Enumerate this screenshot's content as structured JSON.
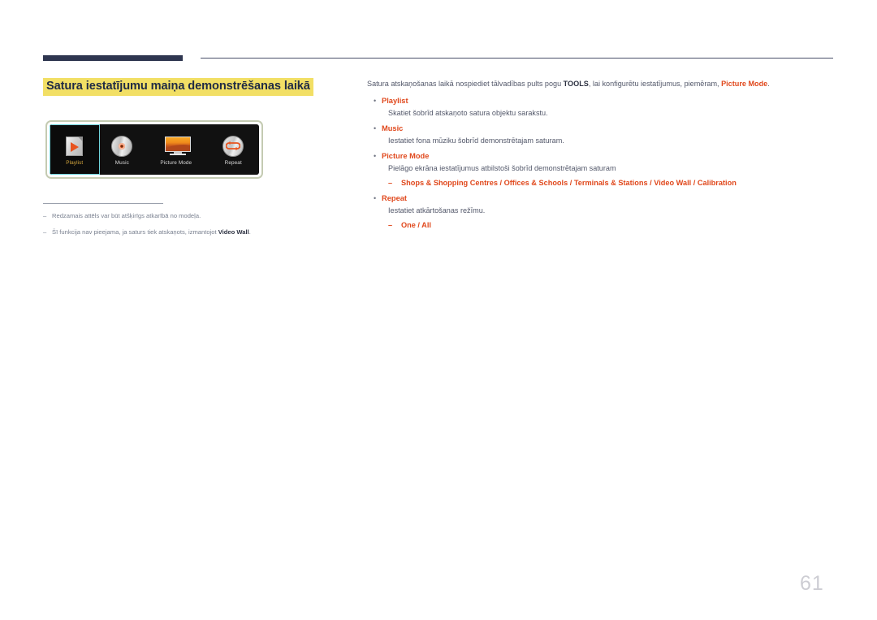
{
  "header": {
    "rule_color": "#2e3650",
    "thin_rule_color": "#4a4f68"
  },
  "left": {
    "title": "Satura iestatījumu maiņa demonstrēšanas laikā",
    "title_highlight_color": "#f2df65",
    "title_text_color": "#1f2a44",
    "device_panel": {
      "frame_color": "#c4cbb2",
      "background_color": "#111111",
      "selected_border_color": "#6fd3db",
      "selected_label_color": "#d8a93f",
      "accent_color": "#e8541f",
      "tiles": [
        {
          "icon": "playlist-document-play-icon",
          "label": "Playlist",
          "selected": true
        },
        {
          "icon": "music-disc-icon",
          "label": "Music",
          "selected": false
        },
        {
          "icon": "picture-mode-monitor-icon",
          "label": "Picture Mode",
          "selected": false
        },
        {
          "icon": "repeat-loop-icon",
          "label": "Repeat",
          "selected": false
        }
      ]
    },
    "footnotes": [
      {
        "dash": "–",
        "text": "Redzamais attēls var būt atšķirīgs atkarībā no modeļa.",
        "bold": ""
      },
      {
        "dash": "–",
        "text": "Šī funkcija nav pieejama, ja saturs tiek atskaņots, izmantojot ",
        "bold": "Video Wall",
        "tail": "."
      }
    ]
  },
  "right": {
    "intro": {
      "part1": "Satura atskaņošanas laikā nospiediet tālvadības pults pogu ",
      "bold_key": "TOOLS",
      "part2": ", lai konfigurētu iestatījumus, piemēram, ",
      "bold_red": "Picture Mode",
      "part3": "."
    },
    "bullet_marker": "•",
    "sub_marker": "–",
    "items": [
      {
        "label": "Playlist",
        "desc": "Skatiet šobrīd atskaņoto satura objektu sarakstu.",
        "options": ""
      },
      {
        "label": "Music",
        "desc": "Iestatiet fona mūziku šobrīd demonstrētajam saturam.",
        "options": ""
      },
      {
        "label": "Picture Mode",
        "desc": "Pielāgo ekrāna iestatījumus atbilstoši šobrīd demonstrētajam saturam",
        "options": "Shops & Shopping Centres / Offices & Schools / Terminals & Stations / Video Wall / Calibration"
      },
      {
        "label": "Repeat",
        "desc": "Iestatiet atkārtošanas režīmu.",
        "options": "One / All"
      }
    ],
    "accent_color": "#e0481c"
  },
  "footer": {
    "page_number": "61"
  }
}
